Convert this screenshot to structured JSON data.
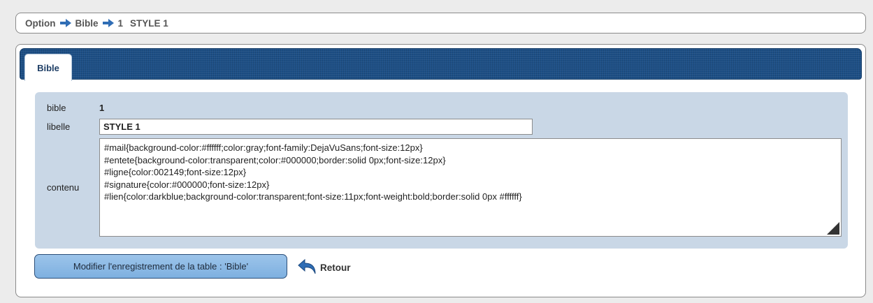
{
  "breadcrumb": {
    "items": [
      "Option",
      "Bible",
      "1",
      "STYLE 1"
    ]
  },
  "tab": {
    "label": "Bible"
  },
  "form": {
    "bible_label": "bible",
    "bible_value": "1",
    "libelle_label": "libelle",
    "libelle_value": "STYLE 1",
    "contenu_label": "contenu",
    "contenu_lines": [
      "#mail{background-color:#ffffff;color:gray;font-family:DejaVuSans;font-size:12px}",
      "#entete{background-color:transparent;color:#000000;border:solid 0px;font-size:12px}",
      "#ligne{color:002149;font-size:12px}",
      "#signature{color:#000000;font-size:12px}",
      "#lien{color:darkblue;background-color:transparent;font-size:11px;font-weight:bold;border:solid 0px #ffffff}"
    ]
  },
  "actions": {
    "modify_label": "Modifier l'enregistrement de la table : 'Bible'",
    "back_label": "Retour"
  },
  "icons": {
    "breadcrumb_separator": "arrow-right-icon",
    "back": "undo-arrow-icon"
  },
  "colors": {
    "tabbar": "#1d4f86",
    "form_background": "#c9d7e6",
    "button": "#8bb9e6",
    "arrow": "#2f6db5"
  }
}
